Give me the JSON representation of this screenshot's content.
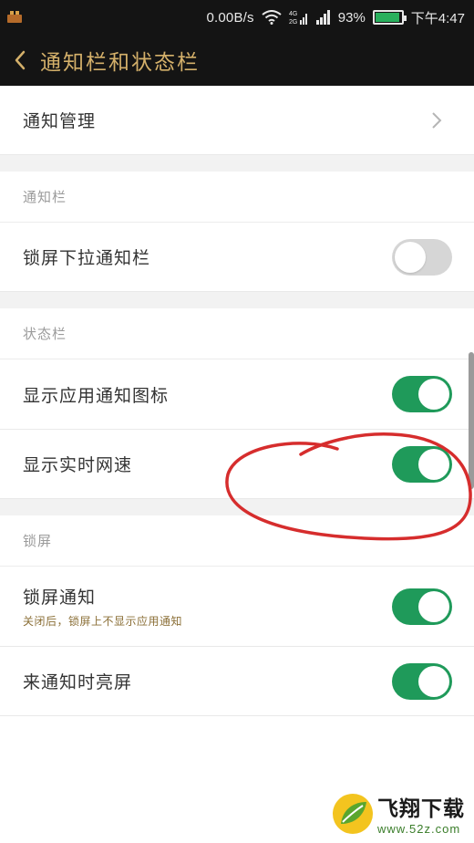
{
  "status_bar": {
    "net_speed": "0.00B/s",
    "network_type": "4G",
    "battery_percent": "93%",
    "battery_level": 0.93,
    "time": "下午4:47"
  },
  "app_bar": {
    "title": "通知栏和状态栏"
  },
  "rows": {
    "notification_management": {
      "label": "通知管理"
    },
    "lockscreen_pulldown": {
      "label": "锁屏下拉通知栏",
      "enabled": false
    },
    "show_app_icons": {
      "label": "显示应用通知图标",
      "enabled": true
    },
    "show_net_speed": {
      "label": "显示实时网速",
      "enabled": true
    },
    "lockscreen_notify": {
      "label": "锁屏通知",
      "subtitle": "关闭后，锁屏上不显示应用通知",
      "enabled": true
    },
    "wake_on_notify": {
      "label": "来通知时亮屏",
      "enabled": true
    }
  },
  "sections": {
    "notification_bar": "通知栏",
    "status_bar": "状态栏",
    "lock_screen": "锁屏"
  },
  "watermark": {
    "brand": "飞翔下载",
    "url": "www.52z.com"
  },
  "colors": {
    "accent": "#d4b06a",
    "toggle_on": "#1f9a5a",
    "toggle_off": "#d6d6d6",
    "annotation": "#d62d2d"
  }
}
